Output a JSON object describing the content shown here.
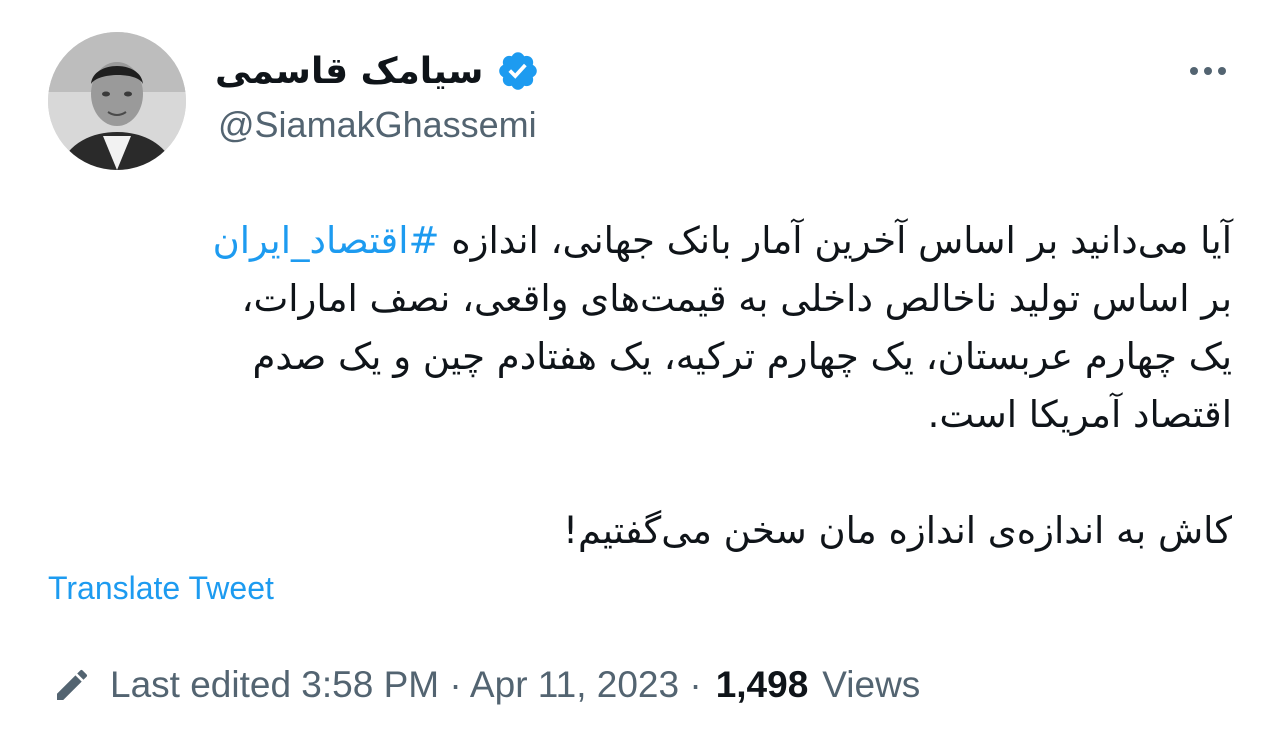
{
  "author": {
    "display_name": "سیامک قاسمی",
    "handle": "@SiamakGhassemi",
    "verified_icon": "verified-badge-icon",
    "avatar": "avatar-photo"
  },
  "more_icon": "more-horizontal-icon",
  "tweet": {
    "line1_prefix": "آیا می‌دانید بر اساس آخرین آمار بانک جهانی، اندازه ",
    "hashtag": "#اقتصاد_ایران",
    "line2": "بر اساس تولید ناخالص داخلی به قیمت‌های واقعی، نصف امارات،",
    "line3": "یک چهارم عربستان، یک چهارم ترکیه، یک هفتادم چین و یک صدم",
    "line4": "اقتصاد آمریکا است.",
    "line5": "کاش به اندازه‌ی اندازه مان سخن می‌گفتیم!"
  },
  "translate_label": "Translate Tweet",
  "meta": {
    "edit_icon": "pencil-icon",
    "edited_label": "Last edited 3:58 PM · Apr 11, 2023 ·",
    "views_count": "1,498",
    "views_label": "Views"
  },
  "colors": {
    "accent": "#1d9bf0",
    "secondary_text": "#536471",
    "primary_text": "#0f1419"
  }
}
